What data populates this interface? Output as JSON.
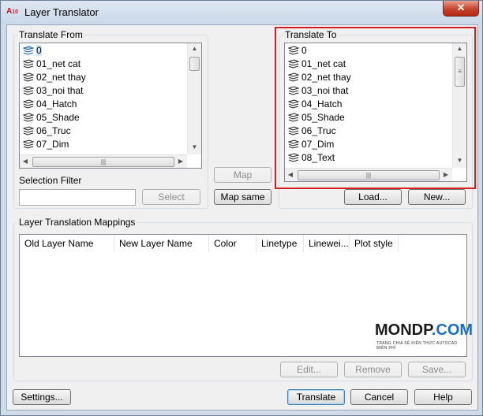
{
  "window": {
    "title": "Layer Translator",
    "app_icon_text": "A",
    "app_icon_sub": "10",
    "close_glyph": "✕"
  },
  "translate_from": {
    "title": "Translate From",
    "layers": [
      "0",
      "01_net cat",
      "02_net thay",
      "03_noi that",
      "04_Hatch",
      "05_Shade",
      "06_Truc",
      "07_Dim"
    ],
    "selected_index": 0
  },
  "translate_to": {
    "title": "Translate To",
    "layers": [
      "0",
      "01_net cat",
      "02_net thay",
      "03_noi that",
      "04_Hatch",
      "05_Shade",
      "06_Truc",
      "07_Dim",
      "08_Text"
    ]
  },
  "selection_filter": {
    "label": "Selection Filter",
    "value": "",
    "select_button": "Select"
  },
  "map_button": "Map",
  "map_same_button": "Map same",
  "load_button": "Load...",
  "new_button": "New...",
  "mappings": {
    "title": "Layer Translation Mappings",
    "columns": [
      "Old Layer Name",
      "New Layer Name",
      "Color",
      "Linetype",
      "Linewei...",
      "Plot style"
    ],
    "rows": []
  },
  "edit_button": "Edit...",
  "remove_button": "Remove",
  "save_button": "Save...",
  "settings_button": "Settings...",
  "translate_button": "Translate",
  "cancel_button": "Cancel",
  "help_button": "Help",
  "watermark": {
    "brand": "MONDP",
    "domain": ".COM",
    "tagline": "TRANG CHIA SẺ KIẾN THỨC AUTOCAD MIỄN PHÍ"
  },
  "colors": {
    "highlight_border": "#d21f1f",
    "selected_row": "#cde5f7"
  }
}
